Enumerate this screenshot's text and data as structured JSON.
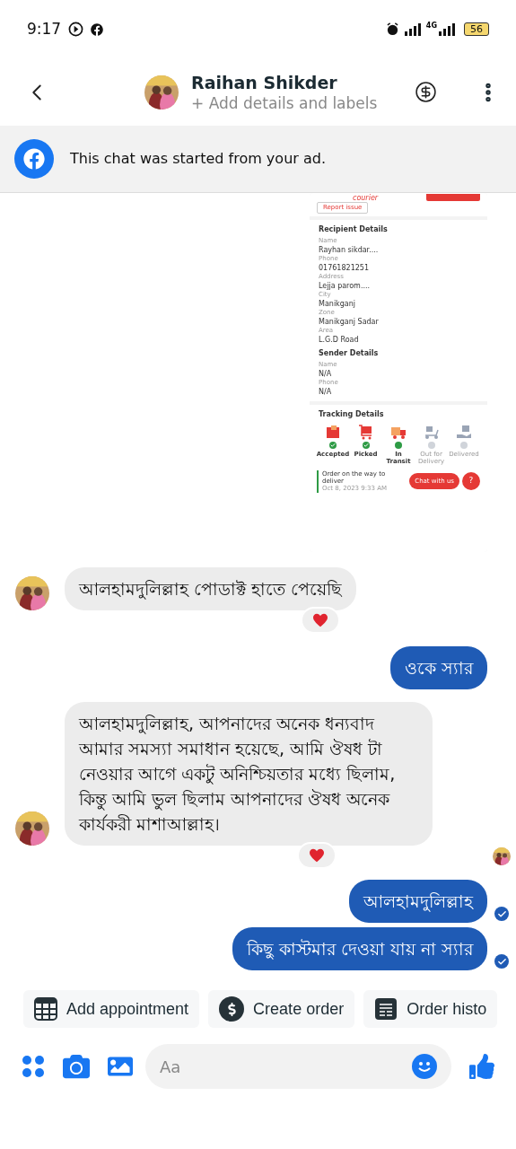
{
  "status_bar": {
    "time": "9:17",
    "network": "4G",
    "battery": "56"
  },
  "header": {
    "name": "Raihan Shikder",
    "subtitle": "+ Add details and labels"
  },
  "banner": {
    "text": "This chat was started from your ad."
  },
  "messages": [
    {
      "kind": "image",
      "outgoing": true,
      "reacted": false,
      "delivered": false,
      "seen": false,
      "screenshot": {
        "brand": "courier",
        "report": "Report issue",
        "recipient": {
          "title": "Recipient Details",
          "fields": [
            {
              "label": "Name",
              "value": "Rayhan sikdar...."
            },
            {
              "label": "Phone",
              "value": "01761821251"
            },
            {
              "label": "Address",
              "value": "Lejja parom...."
            },
            {
              "label": "City",
              "value": "Manikganj"
            },
            {
              "label": "Zone",
              "value": "Manikganj Sadar"
            },
            {
              "label": "Area",
              "value": "L.G.D Road"
            }
          ]
        },
        "sender": {
          "title": "Sender Details",
          "fields": [
            {
              "label": "Name",
              "value": "N/A"
            },
            {
              "label": "Phone",
              "value": "N/A"
            }
          ]
        },
        "tracking": {
          "title": "Tracking Details",
          "steps": [
            {
              "label": "Accepted",
              "done": true,
              "active": false,
              "kind": "box"
            },
            {
              "label": "Picked",
              "done": true,
              "active": false,
              "kind": "cart"
            },
            {
              "label": "In Transit",
              "done": false,
              "active": true,
              "kind": "truck"
            },
            {
              "label": "Out for Delivery",
              "done": false,
              "active": false,
              "kind": "scooter"
            },
            {
              "label": "Delivered",
              "done": false,
              "active": false,
              "kind": "hand"
            }
          ],
          "event": {
            "text": "Order on the way to deliver",
            "time": "Oct 8, 2023 9:33 AM"
          }
        },
        "chat_button": "Chat with us",
        "help_button": "?"
      }
    },
    {
      "kind": "text",
      "outgoing": false,
      "text": "আলহামদুলিল্লাহ পোডাক্ট হাতে পেয়েছি",
      "reacted": true,
      "delivered": false,
      "seen": false
    },
    {
      "kind": "text",
      "outgoing": true,
      "text": "ওকে স্যার",
      "reacted": false,
      "delivered": false,
      "seen": false
    },
    {
      "kind": "text",
      "outgoing": false,
      "text": "আলহামদুলিল্লাহ, আপনাদের অনেক ধন্যবাদ আমার সমস্যা সমাধান হয়েছে, আমি ঔষধ টা নেওয়ার আগে একটু অনিশ্চিয়তার মধ্যে ছিলাম, কিন্তু আমি ভুল ছিলাম আপনাদের ঔষধ অনেক কার্যকরী মাশাআল্লাহ।",
      "reacted": true,
      "delivered": false,
      "seen": true
    },
    {
      "kind": "text",
      "outgoing": true,
      "text": "আলহামদুলিল্লাহ",
      "reacted": false,
      "delivered": true,
      "seen": false
    },
    {
      "kind": "text",
      "outgoing": true,
      "text": "কিছু কাস্টমার দেওয়া যায় না স্যার",
      "reacted": false,
      "delivered": true,
      "seen": false
    }
  ],
  "quick_replies": [
    {
      "label": "Add appointment",
      "kind": "calendar"
    },
    {
      "label": "Create order",
      "kind": "dollar"
    },
    {
      "label": "Order histo",
      "kind": "list"
    }
  ],
  "composer": {
    "placeholder": "Aa"
  }
}
